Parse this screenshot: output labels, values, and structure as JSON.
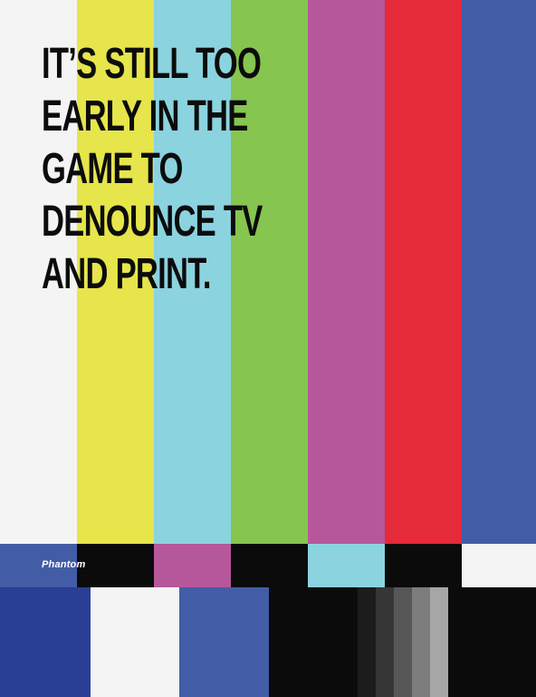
{
  "headline": {
    "lines": [
      "IT’S STILL TOO",
      "EARLY IN THE",
      "GAME TO",
      "DENOUNCE TV",
      "AND PRINT."
    ]
  },
  "brand": {
    "name": "Phantom"
  },
  "colors": {
    "white": "#f4f4f4",
    "yellow": "#e6e54b",
    "cyan": "#8bd3df",
    "green": "#86c550",
    "magenta": "#b7579b",
    "red": "#e52a3a",
    "blue": "#435ca6",
    "black": "#0b0b0b",
    "navy": "#293f95"
  }
}
